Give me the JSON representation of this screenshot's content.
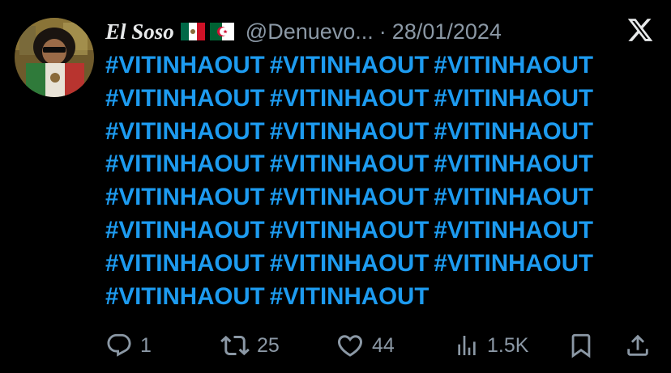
{
  "author": {
    "display_name": "El Soso",
    "flags": [
      "mexico-flag",
      "algeria-flag"
    ],
    "handle": "@Denuevo...",
    "separator": "·",
    "date": "28/01/2024"
  },
  "brand": {
    "icon": "x-logo-icon"
  },
  "body": {
    "hashtag_text": "#VITINHAOUT",
    "lines": [
      [
        "#VITINHAOUT",
        "#VITINHAOUT",
        "#VITINHAOUT"
      ],
      [
        "#VITINHAOUT",
        "#VITINHAOUT",
        "#VITINHAOUT"
      ],
      [
        "#VITINHAOUT",
        "#VITINHAOUT",
        "#VITINHAOUT"
      ],
      [
        "#VITINHAOUT",
        "#VITINHAOUT",
        "#VITINHAOUT"
      ],
      [
        "#VITINHAOUT",
        "#VITINHAOUT",
        "#VITINHAOUT"
      ],
      [
        "#VITINHAOUT",
        "#VITINHAOUT",
        "#VITINHAOUT"
      ],
      [
        "#VITINHAOUT",
        "#VITINHAOUT",
        "#VITINHAOUT"
      ],
      [
        "#VITINHAOUT",
        "#VITINHAOUT"
      ]
    ]
  },
  "actions": {
    "reply": {
      "icon": "reply-icon",
      "count": "1"
    },
    "repost": {
      "icon": "repost-icon",
      "count": "25"
    },
    "like": {
      "icon": "heart-icon",
      "count": "44"
    },
    "views": {
      "icon": "views-icon",
      "count": "1.5K"
    },
    "bookmark": {
      "icon": "bookmark-icon"
    },
    "share": {
      "icon": "share-icon"
    }
  },
  "colors": {
    "background": "#000000",
    "hashtag": "#1d9bf0",
    "name": "#e7e9ea",
    "secondary": "#8b98a5"
  }
}
